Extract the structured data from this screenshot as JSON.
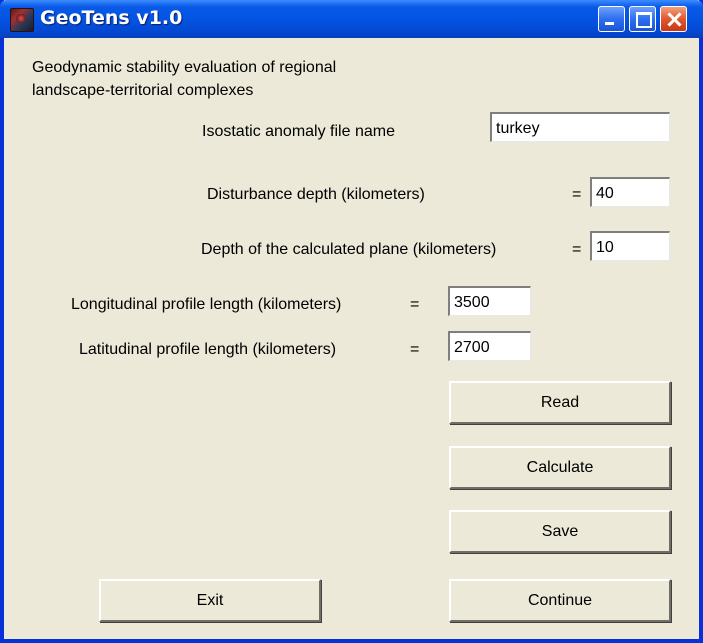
{
  "window": {
    "title": "GeoTens v1.0",
    "icon": "geotens-app-icon",
    "controls": [
      "minimize-icon",
      "maximize-icon",
      "close-icon"
    ]
  },
  "description": {
    "line1": "Geodynamic stability evaluation of regional",
    "line2": "landscape-territorial complexes"
  },
  "fields": {
    "anomaly_file": {
      "label": "Isostatic anomaly file name",
      "value": "turkey"
    },
    "disturbance_depth": {
      "label": "Disturbance depth (kilometers)",
      "eq": "=",
      "value": "40"
    },
    "plane_depth": {
      "label": "Depth of the calculated plane (kilometers)",
      "eq": "=",
      "value": "10"
    },
    "longitudinal_length": {
      "label": "Longitudinal profile length (kilometers)",
      "eq": "=",
      "value": "3500"
    },
    "latitudinal_length": {
      "label": "Latitudinal profile length (kilometers)",
      "eq": "=",
      "value": "2700"
    }
  },
  "buttons": {
    "read": "Read",
    "calculate": "Calculate",
    "save": "Save",
    "exit": "Exit",
    "continue": "Continue"
  },
  "colors": {
    "titlebar": "#0454e3",
    "face": "#ece9d8",
    "close": "#e2572e"
  }
}
